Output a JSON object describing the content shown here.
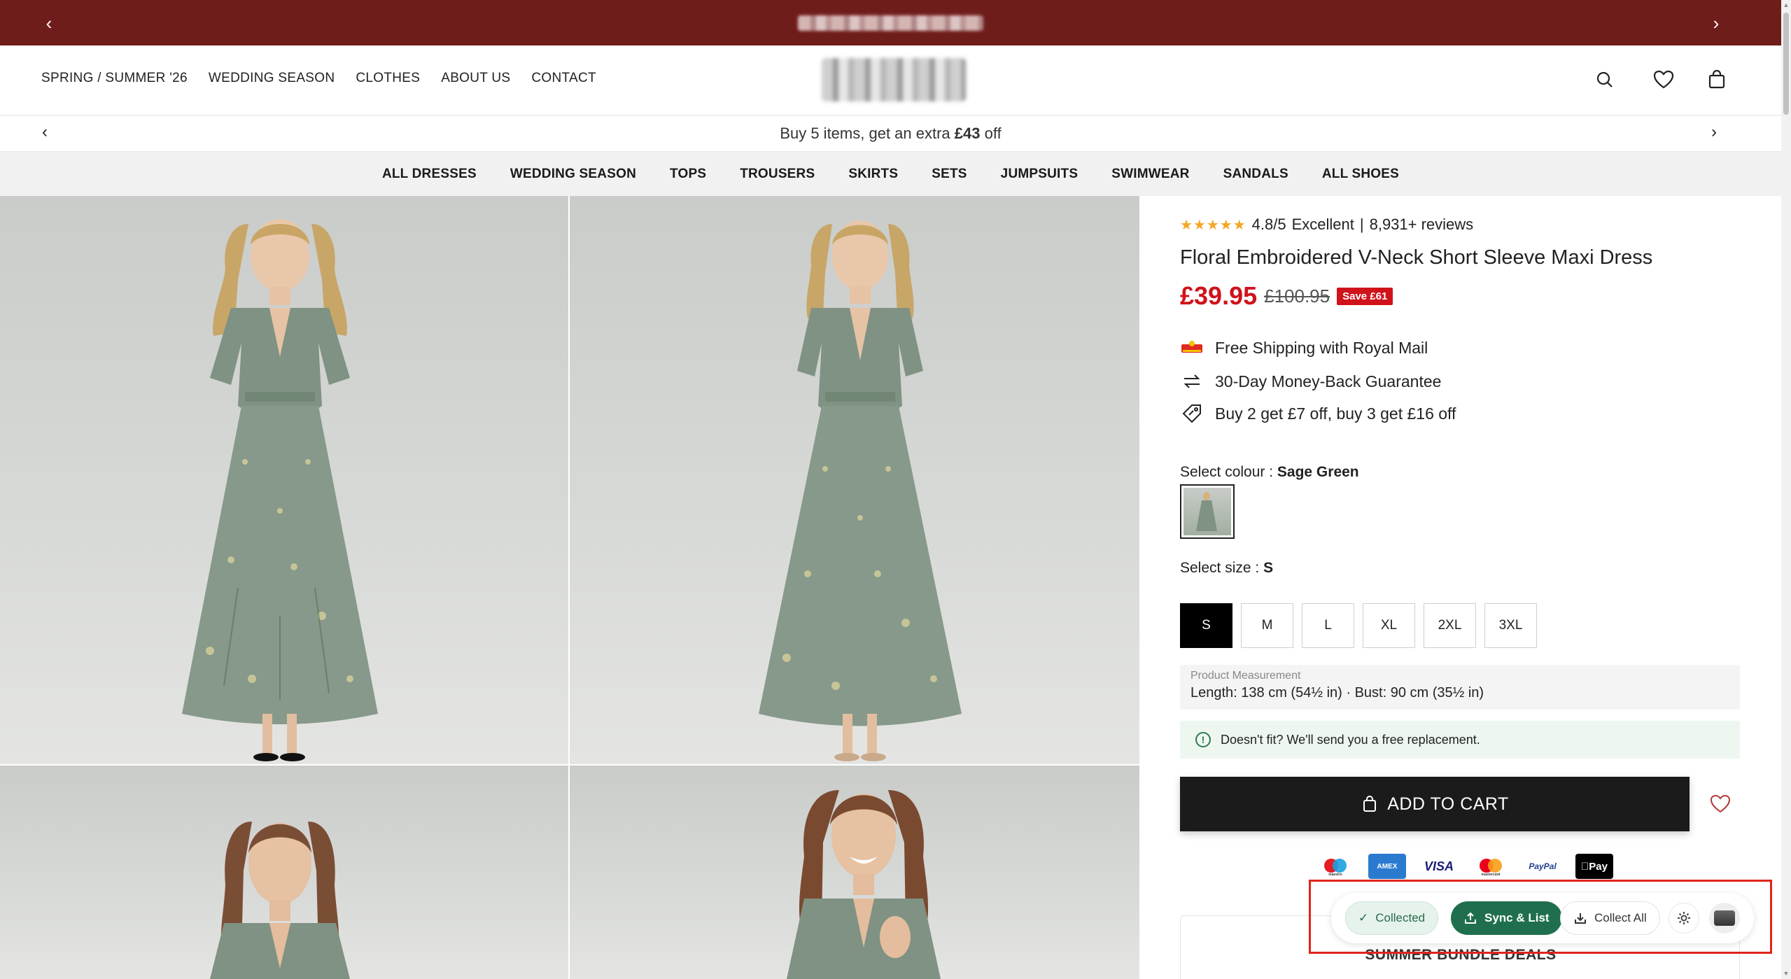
{
  "announcement": {
    "text_blurred": true
  },
  "header": {
    "nav": [
      "SPRING / SUMMER '26",
      "WEDDING SEASON",
      "CLOTHES",
      "ABOUT US",
      "CONTACT"
    ]
  },
  "promo": {
    "prefix": "Buy 5 items, get an extra ",
    "amount": "£43",
    "suffix": " off"
  },
  "categories": [
    "ALL DRESSES",
    "WEDDING SEASON",
    "TOPS",
    "TROUSERS",
    "SKIRTS",
    "SETS",
    "JUMPSUITS",
    "SWIMWEAR",
    "SANDALS",
    "ALL SHOES"
  ],
  "product": {
    "stars": "★★★★★",
    "rating": "4.8/5",
    "rating_word": "Excellent",
    "separator": "|",
    "reviews": "8,931+ reviews",
    "title": "Floral Embroidered V-Neck Short Sleeve Maxi Dress",
    "price": "£39.95",
    "old_price": "£100.95",
    "save": "Save £61",
    "perks": [
      "Free Shipping with Royal Mail",
      "30-Day Money-Back Guarantee",
      "Buy 2 get £7 off, buy 3 get £16 off"
    ],
    "colour_label": "Select colour : ",
    "colour_value": "Sage Green",
    "size_label": "Select size : ",
    "size_value": "S",
    "sizes": [
      "S",
      "M",
      "L",
      "XL",
      "2XL",
      "3XL"
    ],
    "measure_label": "Product Measurement",
    "measure_value": "Length: 138 cm (54½ in) · Bust: 90 cm (35½ in)",
    "fit_note": "Doesn't fit? We'll send you a free replacement.",
    "add_to_cart": "ADD TO CART",
    "payments": [
      "maestro",
      "AMEX",
      "VISA",
      "mastercard",
      "PayPal",
      "Pay"
    ],
    "bundle_title": "SUMMER BUNDLE DEALS"
  },
  "extension": {
    "collected": "Collected",
    "sync": "Sync & List",
    "collect_all": "Collect All"
  },
  "colors": {
    "announcement_bg": "#6f1d1b",
    "price_red": "#d0121b",
    "ext_green": "#1f6f4e",
    "highlight_box": "#e0251b"
  }
}
